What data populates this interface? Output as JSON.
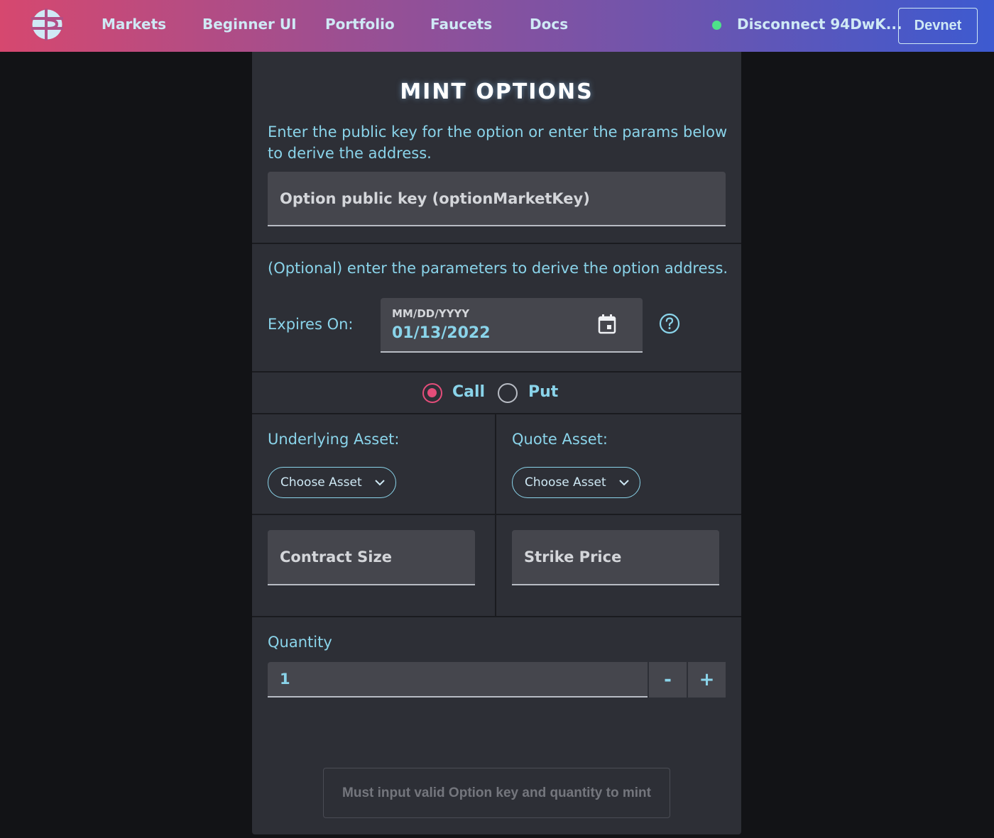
{
  "nav": {
    "links": [
      "Markets",
      "Beginner UI",
      "Portfolio",
      "Faucets",
      "Docs"
    ],
    "wallet_label": "Disconnect 94DwK...",
    "network_label": "Devnet"
  },
  "mint": {
    "title": "MINT OPTIONS",
    "description": "Enter the public key for the option or enter the params below to derive the address.",
    "option_key_placeholder": "Option public key (optionMarketKey)",
    "optional_hint": "(Optional) enter the parameters to derive the option address.",
    "expires_label": "Expires On:",
    "date_format": "MM/DD/YYYY",
    "date_value": "01/13/2022",
    "call_label": "Call",
    "put_label": "Put",
    "selected_type": "Call",
    "underlying_label": "Underlying Asset:",
    "quote_label": "Quote Asset:",
    "choose_asset": "Choose Asset",
    "contract_size_placeholder": "Contract Size",
    "strike_price_placeholder": "Strike Price",
    "quantity_label": "Quantity",
    "quantity_value": "1",
    "minus_label": "-",
    "plus_label": "+",
    "submit_label": "Must input valid Option key and quantity to mint"
  },
  "colors": {
    "accent_cyan": "#8ad4ea",
    "radio_selected": "#e44d7a",
    "status_connected": "#4ee28a"
  }
}
